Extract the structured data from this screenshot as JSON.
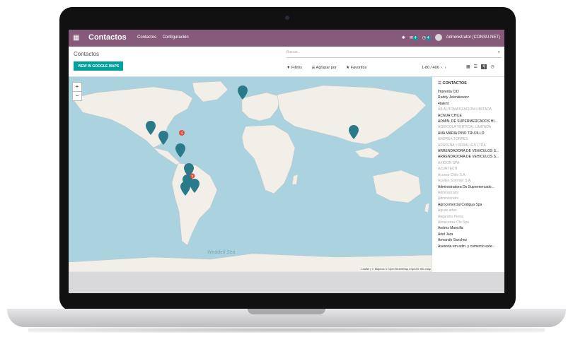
{
  "app": {
    "title": "Contactos",
    "menu": [
      "Contactos",
      "Configuración"
    ],
    "badges": {
      "chat": "4",
      "activity": "4"
    },
    "user": "Administrator (CONSU.NET)"
  },
  "control": {
    "breadcrumb": "Contactos",
    "search_placeholder": "Buscar...",
    "gmaps_button": "VIEW IN GOOGLE MAPS",
    "filters_label": "Filtros",
    "groupby_label": "Agrupar por",
    "favorites_label": "Favoritos",
    "pager": "1-80 / 406"
  },
  "map": {
    "zoom_in": "+",
    "zoom_out": "−",
    "ocean_label": "Weddell Sea",
    "attribution": "Leaflet | © Mapbox © OpenStreetMap Improve this map",
    "clusters": [
      "4",
      "3"
    ]
  },
  "sidebar": {
    "title": "CONTACTOS",
    "contacts": [
      {
        "name": "Imprenta CID",
        "dim": false
      },
      {
        "name": "Ruddy Jelenkiewicz",
        "dim": false
      },
      {
        "name": "4talent",
        "dim": false
      },
      {
        "name": "AB AUTOMATIZACION LIMITADA",
        "dim": true
      },
      {
        "name": "ACNUR CHILE",
        "dim": false
      },
      {
        "name": "ADMIN. DE SUPERMERCADOS HI...",
        "dim": false
      },
      {
        "name": "AGRICOLA VERTICAL LIMITADA",
        "dim": true
      },
      {
        "name": "ANA MARIA PINO TRUJILLO",
        "dim": false
      },
      {
        "name": "ANDREA TORRES",
        "dim": true
      },
      {
        "name": "ARAVENA Y MIRALLES LTDA",
        "dim": true
      },
      {
        "name": "ARRENDADORA DE VEHICULOS S...",
        "dim": false
      },
      {
        "name": "ARRENDADORA DE VEHICULOS S...",
        "dim": false
      },
      {
        "name": "AXIOON SPA",
        "dim": true
      },
      {
        "name": "AZURTECH",
        "dim": true
      },
      {
        "name": "Acceso Chile S.A.",
        "dim": true
      },
      {
        "name": "Aceites Sommer S.A.",
        "dim": true
      },
      {
        "name": "Administradora De Supermercado...",
        "dim": false
      },
      {
        "name": "Administrator",
        "dim": true
      },
      {
        "name": "Administrator",
        "dim": true
      },
      {
        "name": "Agrocomercial Codigua Spa",
        "dim": false
      },
      {
        "name": "Aguas artas",
        "dim": true
      },
      {
        "name": "Alejandro Perea",
        "dim": true
      },
      {
        "name": "Almacenes Cfx Spa",
        "dim": true
      },
      {
        "name": "Andres Mancilla",
        "dim": false
      },
      {
        "name": "Ariel Jara",
        "dim": false
      },
      {
        "name": "Armando Sanchez",
        "dim": false
      },
      {
        "name": "Asesoria em adm. y comercio exte...",
        "dim": false
      }
    ]
  },
  "colors": {
    "brand": "#875a7b",
    "accent": "#00a09d",
    "marker": "#2b7a8a",
    "ocean": "#aad3df",
    "land": "#f2efe9"
  }
}
